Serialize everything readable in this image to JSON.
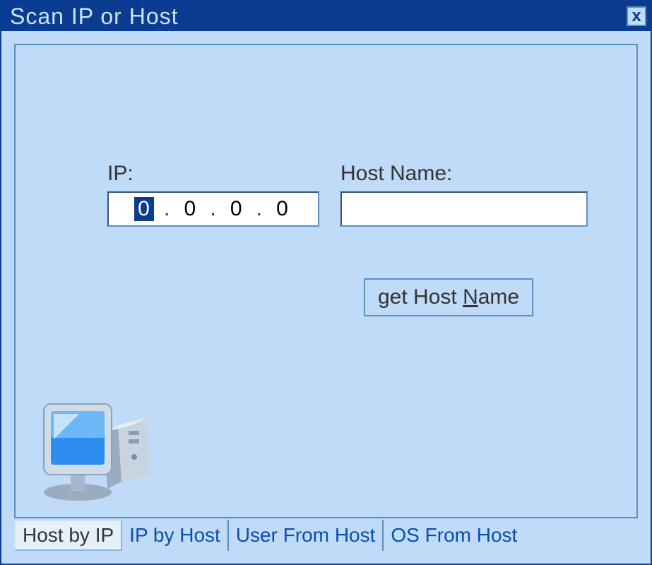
{
  "window": {
    "title": "Scan IP or Host",
    "close_label": "x"
  },
  "form": {
    "ip_label": "IP:",
    "ip_octets": [
      "0",
      "0",
      "0",
      "0"
    ],
    "hostname_label": "Host Name:",
    "hostname_value": "",
    "button_prefix": "get Host ",
    "button_accel": "N",
    "button_suffix": "ame"
  },
  "tabs": {
    "items": [
      {
        "label": "Host by IP",
        "active": true
      },
      {
        "label": "IP by Host",
        "active": false
      },
      {
        "label": "User From Host",
        "active": false
      },
      {
        "label": "OS From Host",
        "active": false
      }
    ]
  }
}
